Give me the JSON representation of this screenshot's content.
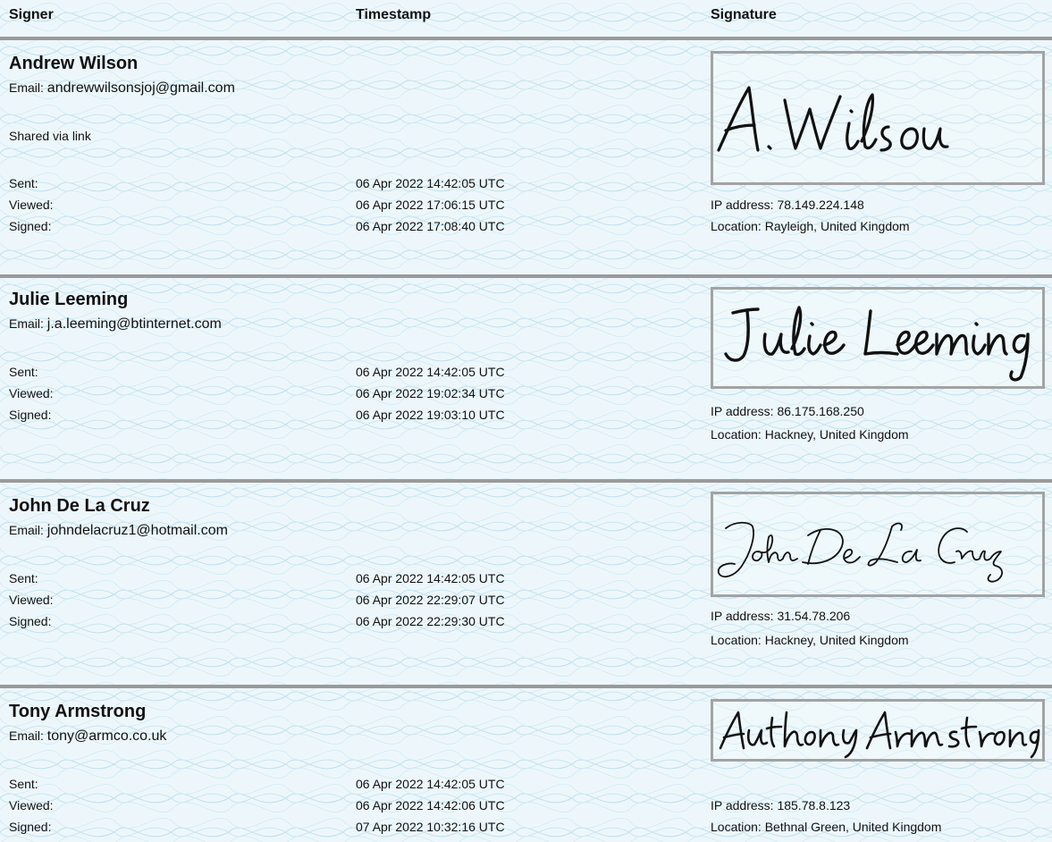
{
  "header": {
    "signer": "Signer",
    "timestamp": "Timestamp",
    "signature": "Signature"
  },
  "signers": [
    {
      "name": "Andrew Wilson",
      "email_label": "Email:",
      "email": "andrewwilsonsjoj@gmail.com",
      "note": "Shared via link",
      "sent_label": "Sent:",
      "sent": "06 Apr 2022 14:42:05 UTC",
      "viewed_label": "Viewed:",
      "viewed": "06 Apr 2022 17:06:15 UTC",
      "signed_label": "Signed:",
      "signed": "06 Apr 2022 17:08:40 UTC",
      "signature_text": "A. Wilson",
      "ip": "IP address: 78.149.224.148",
      "location": "Location: Rayleigh, United Kingdom"
    },
    {
      "name": "Julie Leeming",
      "email_label": "Email:",
      "email": "j.a.leeming@btinternet.com",
      "sent_label": "Sent:",
      "sent": "06 Apr 2022 14:42:05 UTC",
      "viewed_label": "Viewed:",
      "viewed": "06 Apr 2022 19:02:34 UTC",
      "signed_label": "Signed:",
      "signed": "06 Apr 2022 19:03:10 UTC",
      "signature_text": "Julie Leeming",
      "ip": "IP address: 86.175.168.250",
      "location": "Location: Hackney, United Kingdom"
    },
    {
      "name": "John De La Cruz",
      "email_label": "Email:",
      "email": "johndelacruz1@hotmail.com",
      "sent_label": "Sent:",
      "sent": "06 Apr 2022 14:42:05 UTC",
      "viewed_label": "Viewed:",
      "viewed": "06 Apr 2022 22:29:07 UTC",
      "signed_label": "Signed:",
      "signed": "06 Apr 2022 22:29:30 UTC",
      "signature_text": "John De La Cruz",
      "ip": "IP address: 31.54.78.206",
      "location": "Location: Hackney, United Kingdom"
    },
    {
      "name": "Tony Armstrong",
      "email_label": "Email:",
      "email": "tony@armco.co.uk",
      "sent_label": "Sent:",
      "sent": "06 Apr 2022 14:42:05 UTC",
      "viewed_label": "Viewed:",
      "viewed": "06 Apr 2022 14:42:06 UTC",
      "signed_label": "Signed:",
      "signed": "07 Apr 2022 10:32:16 UTC",
      "signature_text": "Anthony Armstrong",
      "ip": "IP address: 185.78.8.123",
      "location": "Location: Bethnal Green, United Kingdom"
    }
  ]
}
